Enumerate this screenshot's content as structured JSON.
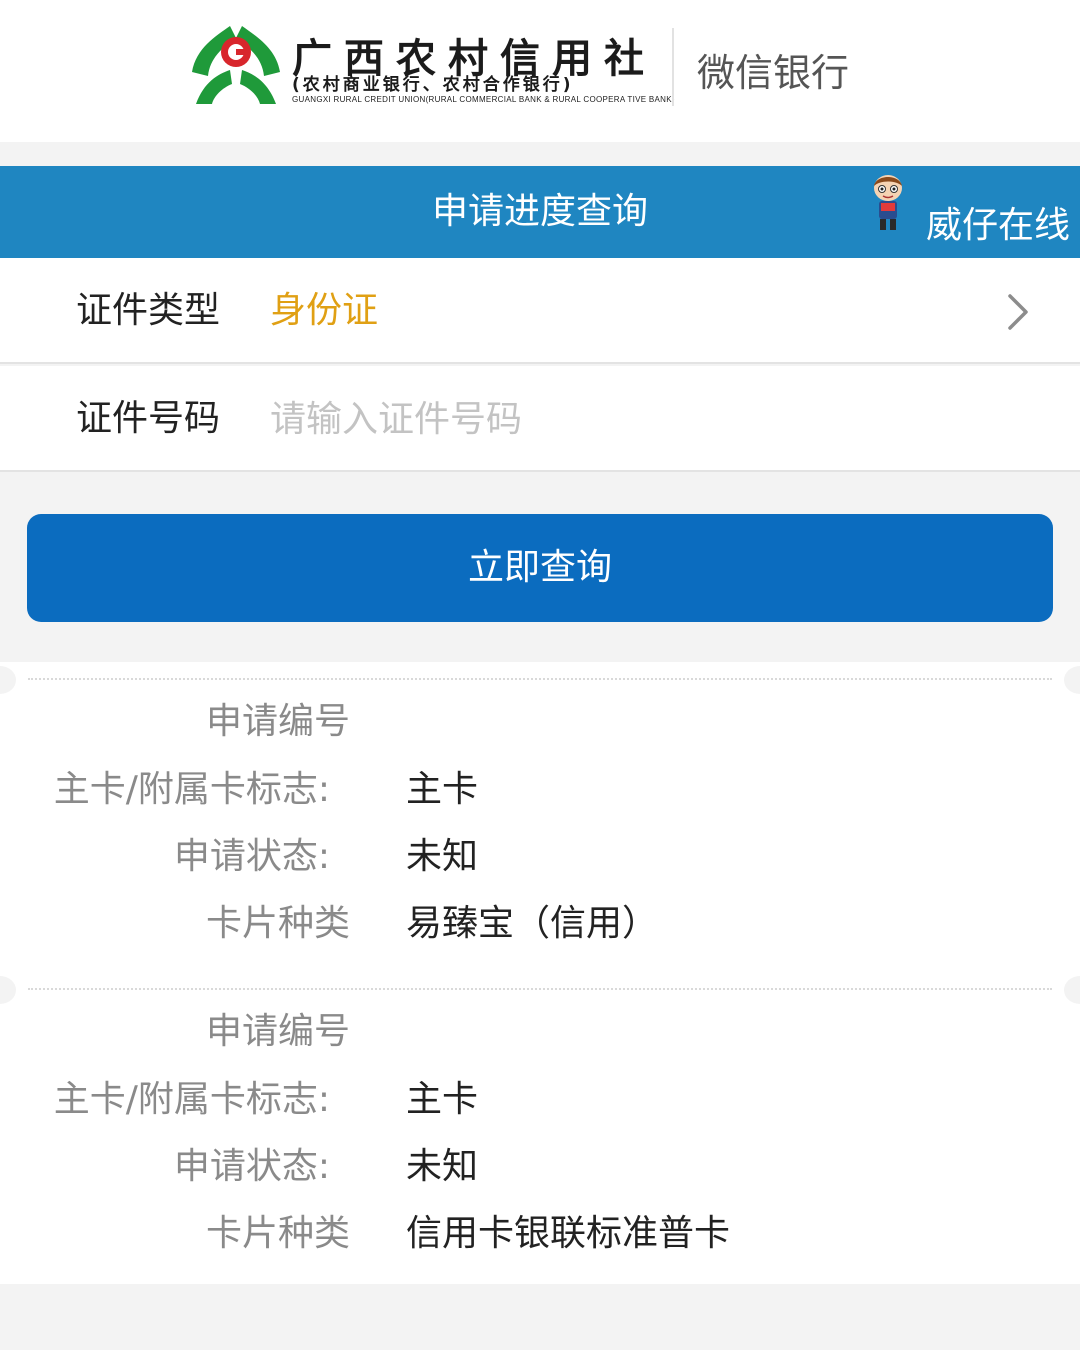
{
  "brand": {
    "name": "广西农村信用社",
    "subtitle": "(农村商业银行、农村合作银行)",
    "english": "GUANGXI RURAL CREDIT UNION(RURAL COMMERCIAL BANK & RURAL COOPERA TIVE BANK)",
    "channel": "微信银行",
    "logo_icon": "rural-credit-logo-icon",
    "colors": {
      "logo_green": "#1f9a3a",
      "logo_red": "#d8262c"
    }
  },
  "header": {
    "title": "申请进度查询",
    "online_label": "威仔在线",
    "online_icon": "mascot-icon",
    "background": "#1f86c1"
  },
  "form": {
    "id_type": {
      "label": "证件类型",
      "value": "身份证",
      "icon": "chevron-right-icon"
    },
    "id_number": {
      "label": "证件号码",
      "placeholder": "请输入证件号码",
      "value": ""
    }
  },
  "query_button": {
    "label": "立即查询",
    "color": "#0b6cbf"
  },
  "results": [
    {
      "app_no_label": "申请编号",
      "app_no": "",
      "card_flag_label": "主卡/附属卡标志:",
      "card_flag": "主卡",
      "status_label": "申请状态:",
      "status": "未知",
      "card_type_label": "卡片种类",
      "card_type": "易臻宝（信用）"
    },
    {
      "app_no_label": "申请编号",
      "app_no": "",
      "card_flag_label": "主卡/附属卡标志:",
      "card_flag": "主卡",
      "status_label": "申请状态:",
      "status": "未知",
      "card_type_label": "卡片种类",
      "card_type": "信用卡银联标准普卡"
    }
  ]
}
